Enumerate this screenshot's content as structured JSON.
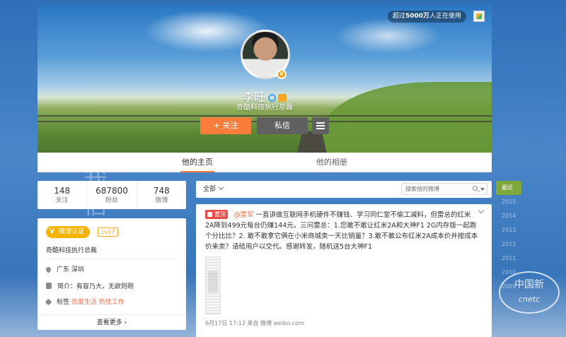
{
  "cover": {
    "users_badge_prefix": "超过",
    "users_badge_count": "5000万",
    "users_badge_suffix": "人正在使用"
  },
  "profile_header": {
    "name": "李旺",
    "title": "奇酷科技执行总裁",
    "follow_label": "+ 关注",
    "message_label": "私信"
  },
  "tabs": [
    {
      "label": "他的主页"
    },
    {
      "label": "他的相册"
    }
  ],
  "stats": [
    {
      "value": "148",
      "label": "关注"
    },
    {
      "value": "687800",
      "label": "粉丝"
    },
    {
      "value": "748",
      "label": "微博"
    }
  ],
  "profile_card": {
    "auth_label": "微博认证",
    "level": "Lv17",
    "description": "奇酷科技执行总裁",
    "location": "广东 深圳",
    "bio": "简介：有容乃大，无欲则刚",
    "tags_label": "标签",
    "tags": "热爱生活 热忱工作",
    "see_more": "查看更多"
  },
  "feed": {
    "filter_label": "全部",
    "search_placeholder": "搜索他的微博"
  },
  "post": {
    "top_tag": "置顶",
    "mention": "@雷军",
    "text": " 一直讲做互联网手机硬件不赚钱、学习同仁堂不偷工减料，但雷总的红米2A降到499元每台仍赚144元。三问雷总：1.您敢不敢让红米2A和大神F1 2G内存版一起跑个分比比？2. 敢不敢拿它俩在小米商城卖一天比销量？3.敢不敢公布红米2A成本价并按成本价来卖？请给用户以交代。感谢转发，随机送5台大神F1",
    "meta": "6月17日 17:12 来自 微博 weibo.com"
  },
  "timeline": {
    "years": [
      "最近",
      "2015",
      "2014",
      "2013",
      "2012",
      "2011",
      "2010",
      "2009"
    ]
  },
  "watermark": {
    "line1": "中国新",
    "line2": "cnetc"
  },
  "decor": {
    "ink_text": "我信"
  }
}
